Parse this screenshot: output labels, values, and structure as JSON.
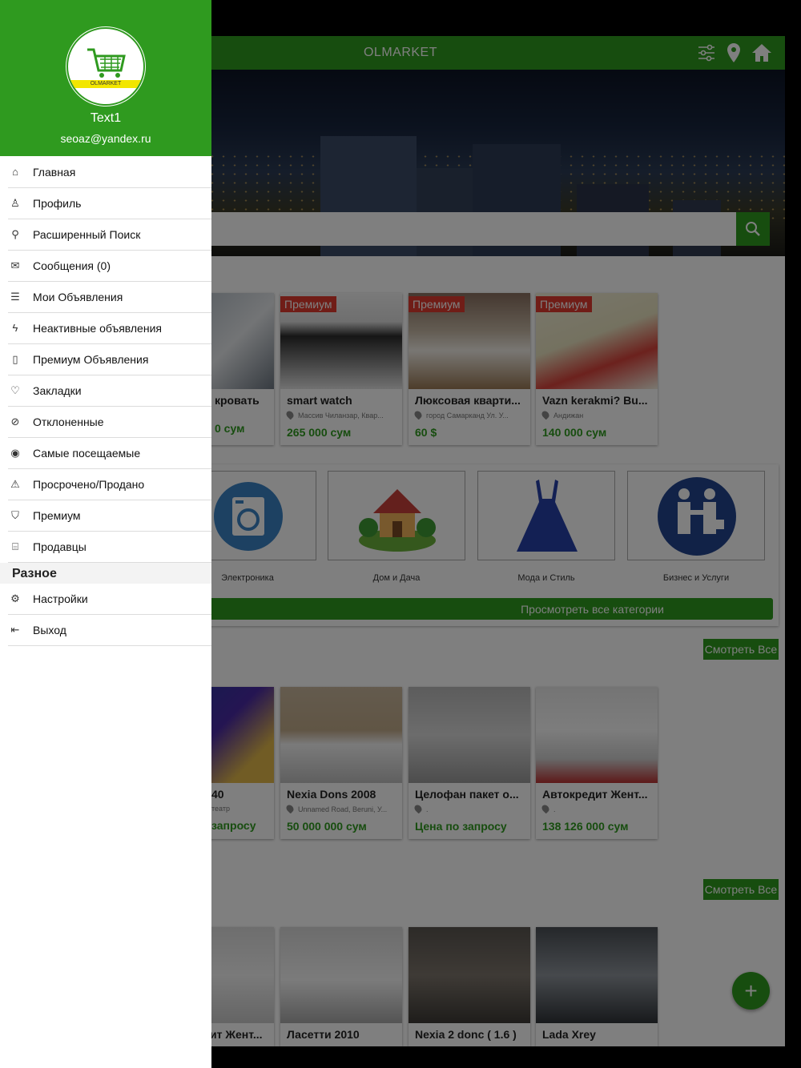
{
  "topbar": {
    "title": "OLMARKET"
  },
  "colors": {
    "brand": "#2f9a1f",
    "badge": "#e03a2f",
    "price": "#2f9a1f"
  },
  "premium_cards": [
    {
      "badge": "",
      "title": "кровать",
      "location": "",
      "price": "0 сум"
    },
    {
      "badge": "Премиум",
      "title": "smart watch",
      "location": "Массив Чиланзар, Квар...",
      "price": "265 000 сум"
    },
    {
      "badge": "Премиум",
      "title": "Люксовая кварти...",
      "location": "город Самарканд Ул. У...",
      "price": "60 $"
    },
    {
      "badge": "Премиум",
      "title": "Vazn kerakmi? Bu...",
      "location": "Андижан",
      "price": "140 000 сум"
    }
  ],
  "categories": [
    {
      "label": "Электроника",
      "icon": "washing-machine-icon"
    },
    {
      "label": "Дом и Дача",
      "icon": "house-icon"
    },
    {
      "label": "Мода и Стиль",
      "icon": "dress-icon"
    },
    {
      "label": "Бизнес и Услуги",
      "icon": "handshake-icon"
    }
  ],
  "view_all_categories": "Просмотреть все категории",
  "see_all": "Смотреть Все",
  "recent_cards": [
    {
      "title": "40",
      "location": "театр",
      "price": "запросу"
    },
    {
      "title": "Nexia Dons 2008",
      "location": "Unnamed Road, Beruni, У...",
      "price": "50 000 000 сум"
    },
    {
      "title": "Целофан пакет о...",
      "location": ".",
      "price": "Цена по запросу"
    },
    {
      "title": "Автокредит Жент...",
      "location": ".",
      "price": "138 126 000 сум"
    }
  ],
  "bottom_cards": [
    {
      "title": "ит Жент..."
    },
    {
      "title": "Ласетти 2010"
    },
    {
      "title": "Nexia 2 donc ( 1.6 )"
    },
    {
      "title": "Lada Xrey"
    }
  ],
  "fab": "+",
  "drawer": {
    "logo_text": "OLMARKET",
    "user_name": "Text1",
    "user_email": "seoaz@yandex.ru",
    "items": [
      {
        "label": "Главная",
        "icon": "home-icon"
      },
      {
        "label": "Профиль",
        "icon": "user-icon"
      },
      {
        "label": "Расширенный Поиск",
        "icon": "search-icon"
      },
      {
        "label": "Сообщения (0)",
        "icon": "mail-icon"
      },
      {
        "label": "Мои Объявления",
        "icon": "list-icon"
      },
      {
        "label": "Неактивные объявления",
        "icon": "bolt-icon"
      },
      {
        "label": "Премиум Объявления",
        "icon": "bookmark-icon"
      },
      {
        "label": "Закладки",
        "icon": "heart-icon"
      },
      {
        "label": "Отклоненные",
        "icon": "blocked-icon"
      },
      {
        "label": "Самые посещаемые",
        "icon": "eye-icon"
      },
      {
        "label": "Просрочено/Продано",
        "icon": "warning-icon"
      },
      {
        "label": "Премиум",
        "icon": "bag-icon"
      },
      {
        "label": "Продавцы",
        "icon": "store-icon"
      }
    ],
    "section_title": "Разное",
    "misc_items": [
      {
        "label": "Настройки",
        "icon": "gear-icon"
      },
      {
        "label": "Выход",
        "icon": "logout-icon"
      }
    ]
  }
}
